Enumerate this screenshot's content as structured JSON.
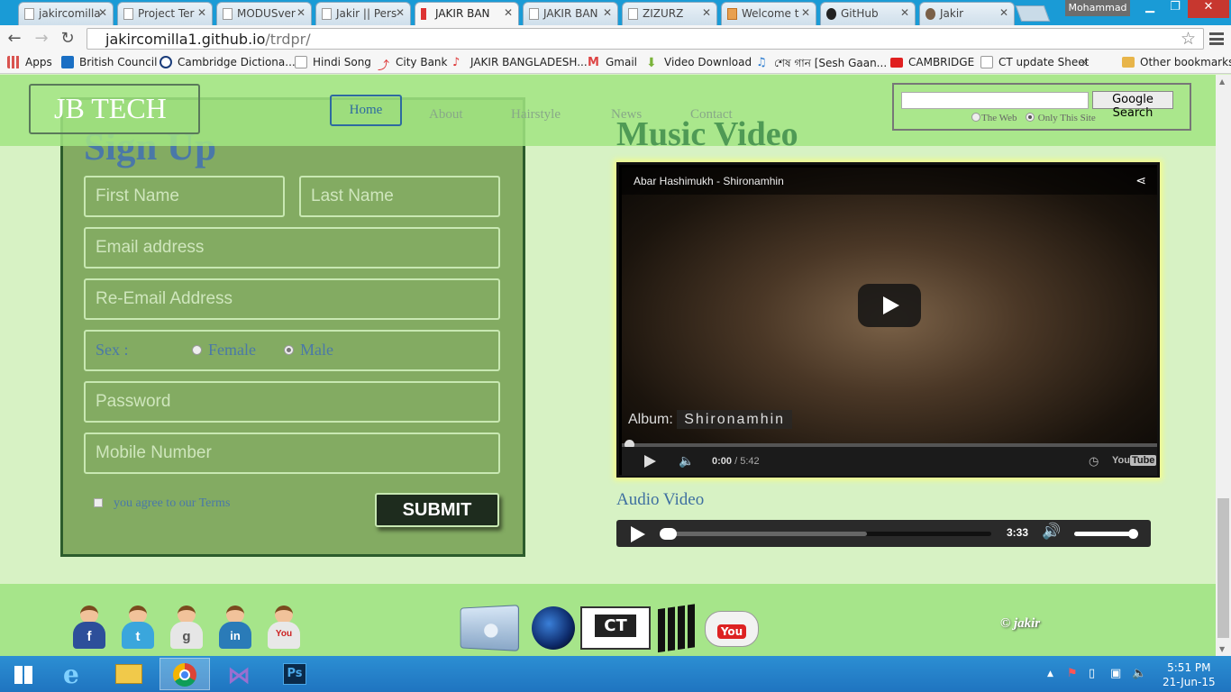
{
  "browser": {
    "tabs": [
      {
        "label": "jakircomilla"
      },
      {
        "label": "Project Ter"
      },
      {
        "label": "MODUSver"
      },
      {
        "label": "Jakir || Pers"
      },
      {
        "label": "JAKIR BAN"
      },
      {
        "label": "JAKIR BAN"
      },
      {
        "label": "ZIZURZ"
      },
      {
        "label": "Welcome t"
      },
      {
        "label": "GitHub"
      },
      {
        "label": "Jakir"
      }
    ],
    "profile_name": "Mohammad",
    "url_host": "jakircomilla1.github.io",
    "url_path": "/trdpr/",
    "bookmarks": [
      {
        "label": "Apps",
        "color": "#d9534f"
      },
      {
        "label": "British Council",
        "color": "#1a6fc4"
      },
      {
        "label": "Cambridge Dictiona...",
        "color": "#1a3c7a"
      },
      {
        "label": "Hindi Song",
        "color": "#ffffff"
      },
      {
        "label": "City Bank",
        "color": "#d33"
      },
      {
        "label": "JAKIR BANGLADESH...",
        "color": "#d33"
      },
      {
        "label": "Gmail",
        "color": "#d44"
      },
      {
        "label": "Video Download",
        "color": "#7ab33a"
      },
      {
        "label": "শেষ গান [Sesh Gaan...",
        "color": "#2a7bd0"
      },
      {
        "label": "CAMBRIDGE",
        "color": "#e02020"
      },
      {
        "label": "CT update Sheet",
        "color": "#ffffff"
      }
    ],
    "bookmarks_overflow": "»",
    "other_bookmarks": "Other bookmarks"
  },
  "site": {
    "logo": "JB TECH",
    "nav": [
      "Home",
      "About",
      "Hairstyle",
      "News",
      "Contact"
    ],
    "search": {
      "button": "Google Search",
      "option_web": "The Web",
      "option_site": "Only This Site"
    },
    "signup": {
      "title": "Sign Up",
      "first_name": "First Name",
      "last_name": "Last Name",
      "email": "Email address",
      "re_email": "Re-Email Address",
      "sex_label": "Sex :",
      "female": "Female",
      "male": "Male",
      "password": "Password",
      "mobile": "Mobile Number",
      "terms": "you agree to our Terms",
      "submit": "SUBMIT"
    },
    "music": {
      "title": "Music Video",
      "video_title": "Abar Hashimukh - Shironamhin",
      "album_label": "Album:",
      "album_name": "Shironamhin",
      "current_time": "0:00",
      "duration": "/ 5:42",
      "youtube": "You",
      "youtube_tube": "Tube",
      "audio_label": "Audio Video",
      "audio_time": "3:33"
    },
    "footer": {
      "copyright": "© jakir",
      "social": [
        {
          "name": "facebook",
          "letter": "f",
          "color": "#2d4f9a"
        },
        {
          "name": "twitter",
          "letter": "t",
          "color": "#3aa6dc"
        },
        {
          "name": "google",
          "letter": "g",
          "color": "#e6e6e6"
        },
        {
          "name": "linkedin",
          "letter": "in",
          "color": "#2a7bb8"
        },
        {
          "name": "youtube",
          "letter": "You",
          "color": "#e8e8e8"
        }
      ],
      "ct_label": "CT",
      "youtube_badge": "You"
    }
  },
  "taskbar": {
    "time": "5:51 PM",
    "date": "21-Jun-15"
  }
}
